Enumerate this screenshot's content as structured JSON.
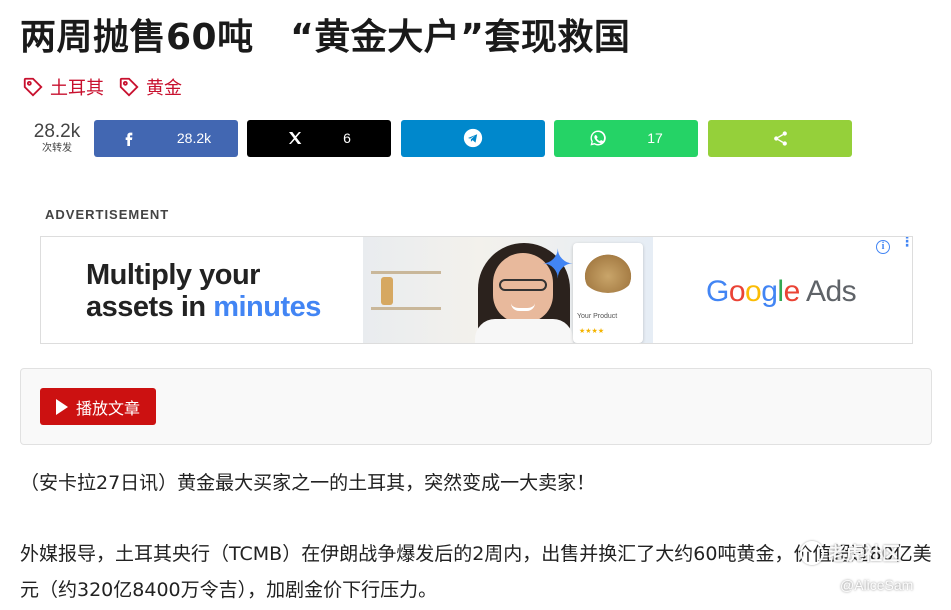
{
  "article": {
    "title": "两周抛售60吨　“黄金大户”套现救国",
    "tags": [
      "土耳其",
      "黄金"
    ]
  },
  "share_bar": {
    "total_count": "28.2k",
    "total_label": "次转发",
    "buttons": [
      {
        "network": "facebook",
        "icon": "facebook-icon",
        "count": "28.2k",
        "color": "#4267b2"
      },
      {
        "network": "x",
        "icon": "x-icon",
        "count": "6",
        "color": "#000000"
      },
      {
        "network": "telegram",
        "icon": "telegram-icon",
        "count": "",
        "color": "#0088cc"
      },
      {
        "network": "whatsapp",
        "icon": "whatsapp-icon",
        "count": "17",
        "color": "#25d366"
      },
      {
        "network": "share",
        "icon": "share-icon",
        "count": "",
        "color": "#95d03a"
      }
    ]
  },
  "advertisement": {
    "label": "ADVERTISEMENT",
    "headline_line1": "Multiply your",
    "headline_line2_prefix": "assets in ",
    "headline_line2_highlight": "minutes",
    "product_name": "Your Product",
    "product_rating": "★★★★",
    "brand_google": "Google",
    "brand_ads": "Ads"
  },
  "player": {
    "button_label": "播放文章"
  },
  "body": {
    "paragraph1": "（安卡拉27日讯）黄金最大买家之一的土耳其，突然变成一大卖家！",
    "paragraph2": "外媒报导，土耳其央行（TCMB）在伊朗战争爆发后的2周内，出售并换汇了大约60吨黄金，价值超过80亿美元（约320亿8400万令吉），加剧金价下行压力。"
  },
  "watermark": {
    "site": "老虎社区",
    "handle": "@AliceSam"
  }
}
